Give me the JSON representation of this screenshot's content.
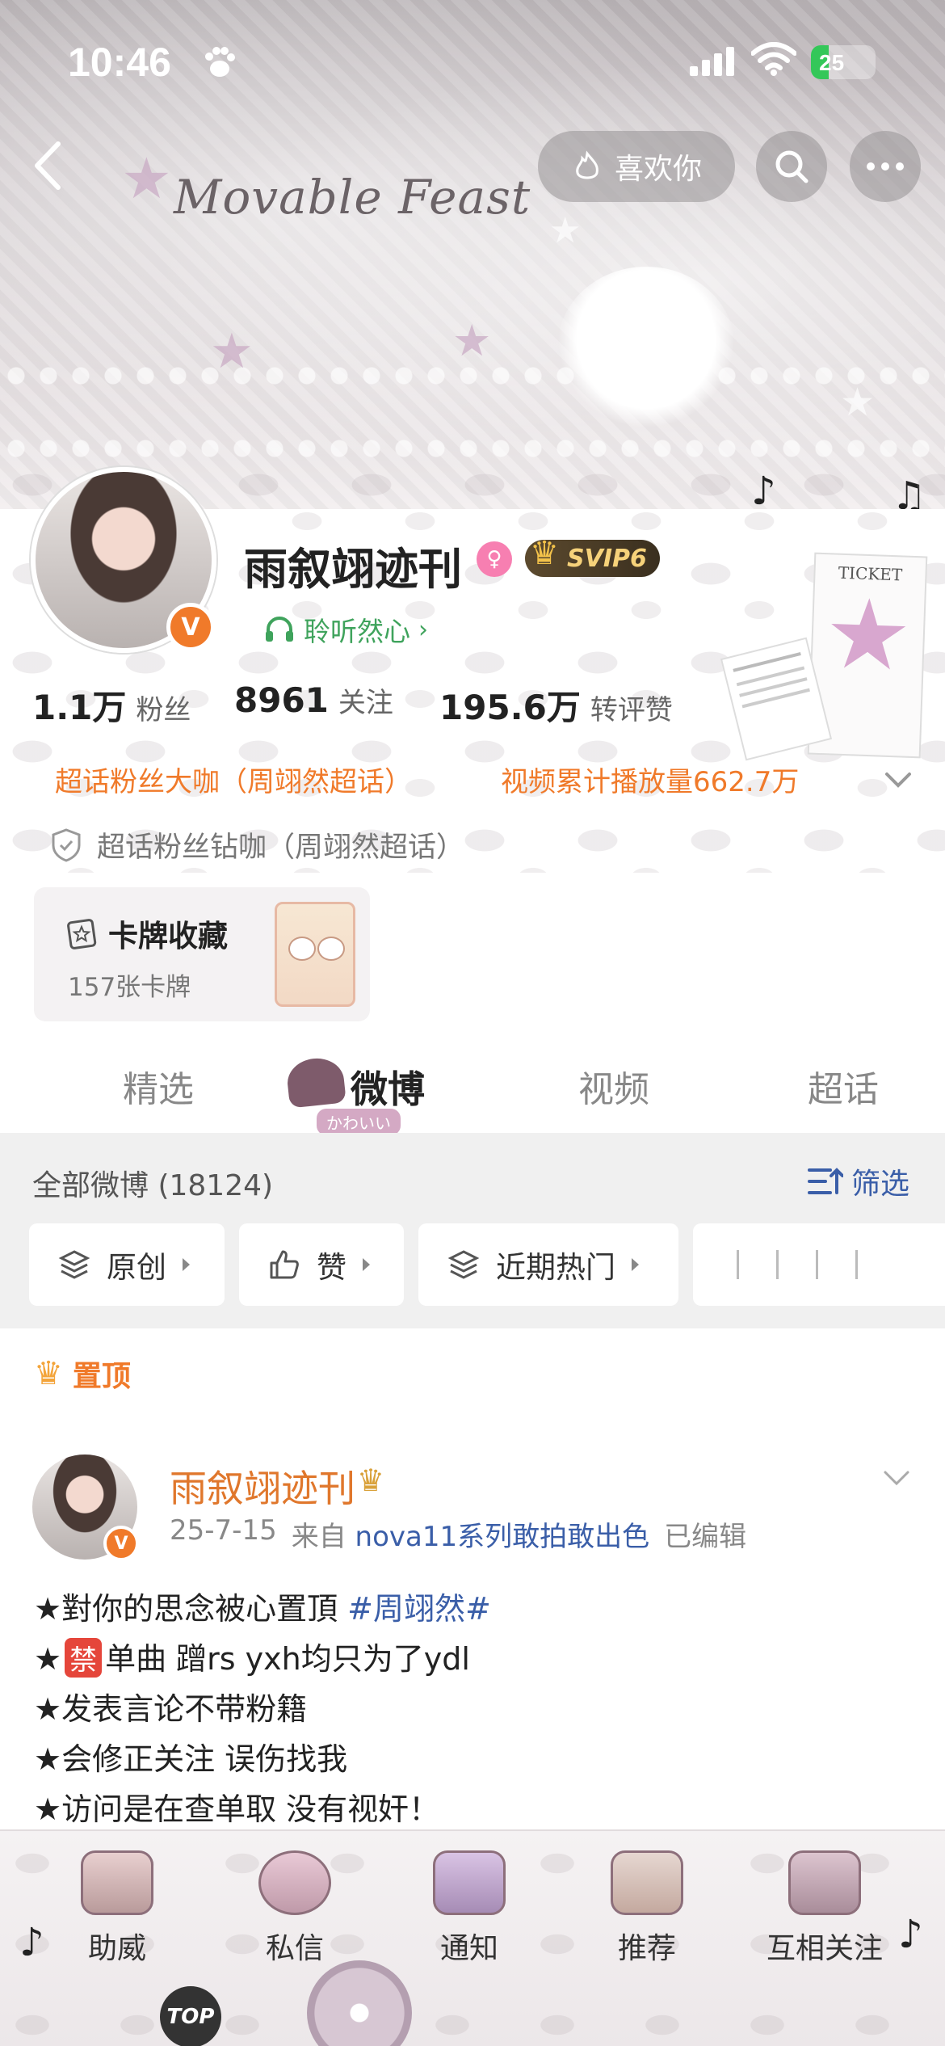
{
  "status_bar": {
    "time": "10:46",
    "battery": "25"
  },
  "nav": {
    "like_label": "喜欢你"
  },
  "profile": {
    "name": "雨叙翊迹刊",
    "vip": "SVIP6",
    "verify_mark": "V",
    "listen_label": "聆听然心",
    "stats": [
      {
        "value": "1.1万",
        "label": "粉丝"
      },
      {
        "value": "8961",
        "label": "关注"
      },
      {
        "value": "195.6万",
        "label": "转评赞"
      }
    ],
    "fan_tag": "超话粉丝大咖（周翊然超话）",
    "video_tag": "视频累计播放量662.7万",
    "diamond_tag": "超话粉丝钻咖（周翊然超话）"
  },
  "card_collection": {
    "title": "卡牌收藏",
    "count": "157张卡牌"
  },
  "tabs": [
    {
      "label": "精选"
    },
    {
      "label": "微博"
    },
    {
      "label": "视频"
    },
    {
      "label": "超话"
    }
  ],
  "tab_deco": "かわいい",
  "feed": {
    "all_label": "全部微博 (18124)",
    "filter_label": "筛选",
    "chips": [
      "原创",
      "赞",
      "近期热门"
    ]
  },
  "pinned_label": "置顶",
  "post": {
    "author": "雨叙翊迹刊",
    "date": "25-7-15",
    "from": "来自",
    "device": "nova11系列敢拍敢出色",
    "edited": "已编辑",
    "lines": {
      "l1_text": "★對你的思念被心置頂 ",
      "l1_tag": "#周翊然#",
      "l2_star": "★",
      "l2_ban": "禁",
      "l2_text": "单曲 蹭rs yxh均只为了ydl",
      "l3": "★发表言论不带粉籍",
      "l4": "★会修正关注 误伤找我",
      "l5": "★访问是在查单取 没有视奸！"
    }
  },
  "bottom_nav": [
    "助威",
    "私信",
    "通知",
    "推荐",
    "互相关注"
  ],
  "top_button": "TOP",
  "banner_deco": {
    "script_title": "Movable Feast",
    "ticket": "TICKET"
  },
  "colors": {
    "accent_orange": "#f07a2a",
    "link_blue": "#3a5ea8",
    "listen_green": "#3fa35c"
  }
}
